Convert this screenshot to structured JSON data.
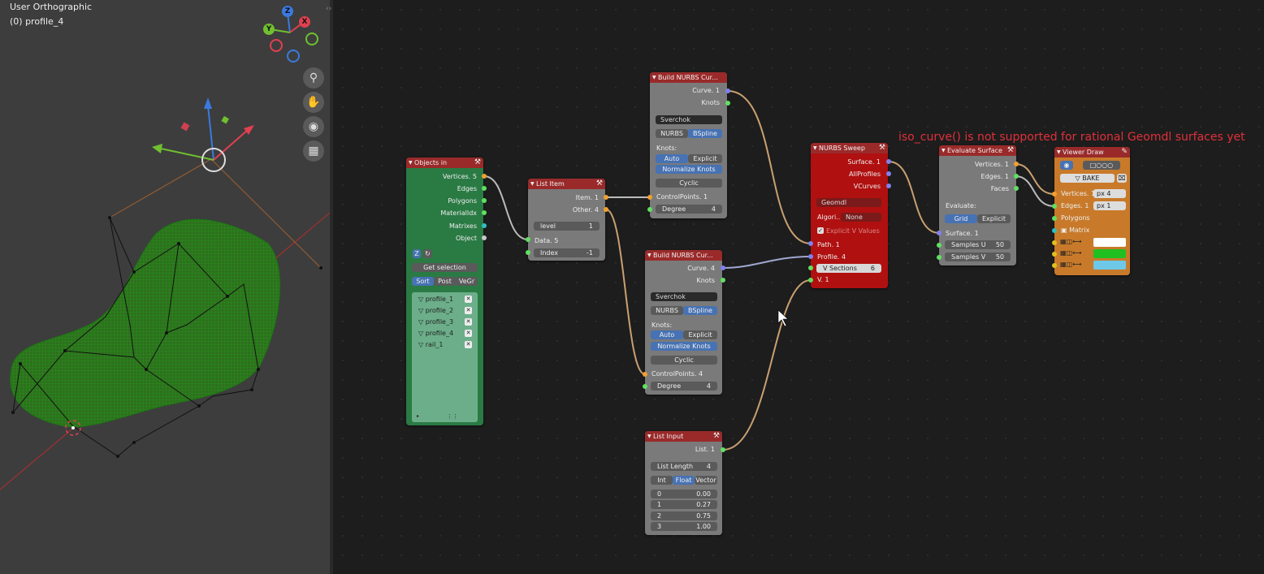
{
  "viewport": {
    "title": "User Orthographic",
    "subtitle": "(0) profile_4",
    "gizmo": {
      "z": "Z",
      "x": "X",
      "y": "Y",
      "origin": "2"
    },
    "nav_icons": [
      "zoom-icon",
      "hand-icon",
      "camera-icon",
      "grid-icon"
    ]
  },
  "error_message": "iso_curve() is not supported for rational Geomdl surfaces yet",
  "nodes": {
    "objects_in": {
      "title": "Objects in",
      "outputs": [
        "Vertices. 5",
        "Edges",
        "Polygons",
        "MaterialIdx",
        "Matrixes",
        "Object"
      ],
      "get_selection": "Get selection",
      "sort_buttons": [
        "Sort",
        "Post",
        "VeGr"
      ],
      "items": [
        "profile_1",
        "profile_2",
        "profile_3",
        "profile_4",
        "rail_1"
      ]
    },
    "list_item": {
      "title": "List Item",
      "outputs": [
        "Item. 1",
        "Other. 4"
      ],
      "level_label": "level",
      "level_value": "1",
      "inputs": [
        "Data. 5"
      ],
      "index_label": "Index",
      "index_value": "-1"
    },
    "nurbs1": {
      "title": "Build NURBS Cur...",
      "outputs": [
        "Curve. 1",
        "Knots"
      ],
      "impl": "Sverchok",
      "modes": [
        "NURBS",
        "BSpline"
      ],
      "knots_label": "Knots:",
      "knot_modes": [
        "Auto",
        "Explicit"
      ],
      "normalize": "Normalize Knots",
      "cyclic": "Cyclic",
      "inputs": [
        "ControlPoints. 1"
      ],
      "degree_label": "Degree",
      "degree_value": "4"
    },
    "nurbs2": {
      "title": "Build NURBS Cur...",
      "outputs": [
        "Curve. 4",
        "Knots"
      ],
      "impl": "Sverchok",
      "modes": [
        "NURBS",
        "BSpline"
      ],
      "knots_label": "Knots:",
      "knot_modes": [
        "Auto",
        "Explicit"
      ],
      "normalize": "Normalize Knots",
      "cyclic": "Cyclic",
      "inputs": [
        "ControlPoints. 4"
      ],
      "degree_label": "Degree",
      "degree_value": "4"
    },
    "list_input": {
      "title": "List Input",
      "outputs": [
        "List. 1"
      ],
      "length_label": "List Length",
      "length_value": "4",
      "types": [
        "Int",
        "Float",
        "Vector"
      ],
      "rows": [
        {
          "i": "0",
          "v": "0.00"
        },
        {
          "i": "1",
          "v": "0.27"
        },
        {
          "i": "2",
          "v": "0.75"
        },
        {
          "i": "3",
          "v": "1.00"
        }
      ]
    },
    "sweep": {
      "title": "NURBS Sweep",
      "outputs": [
        "Surface. 1",
        "AllProfiles",
        "VCurves"
      ],
      "impl": "Geomdl",
      "algo_label": "Algori...",
      "algo_value": "None",
      "explicit_v": "Explicit V Values",
      "inputs": [
        "Path. 1",
        "Profile. 4"
      ],
      "vsections_label": "V Sections",
      "vsections_value": "6",
      "v_input": "V. 1"
    },
    "evaluate": {
      "title": "Evaluate Surface",
      "outputs": [
        "Vertices. 1",
        "Edges. 1",
        "Faces"
      ],
      "evaluate_label": "Evaluate:",
      "eval_modes": [
        "Grid",
        "Explicit"
      ],
      "inputs": [
        "Surface. 1"
      ],
      "samples_u_label": "Samples U",
      "samples_u_value": "50",
      "samples_v_label": "Samples V",
      "samples_v_value": "50"
    },
    "viewer": {
      "title": "Viewer Draw",
      "bake": "BAKE",
      "inputs": [
        "Vertices. 1",
        "Edges. 1",
        "Polygons",
        "Matrix"
      ],
      "vert_px": "px  4",
      "edge_px": "px  1",
      "colors": [
        "#ffffff",
        "#20c020",
        "#6ec8e8"
      ]
    }
  }
}
